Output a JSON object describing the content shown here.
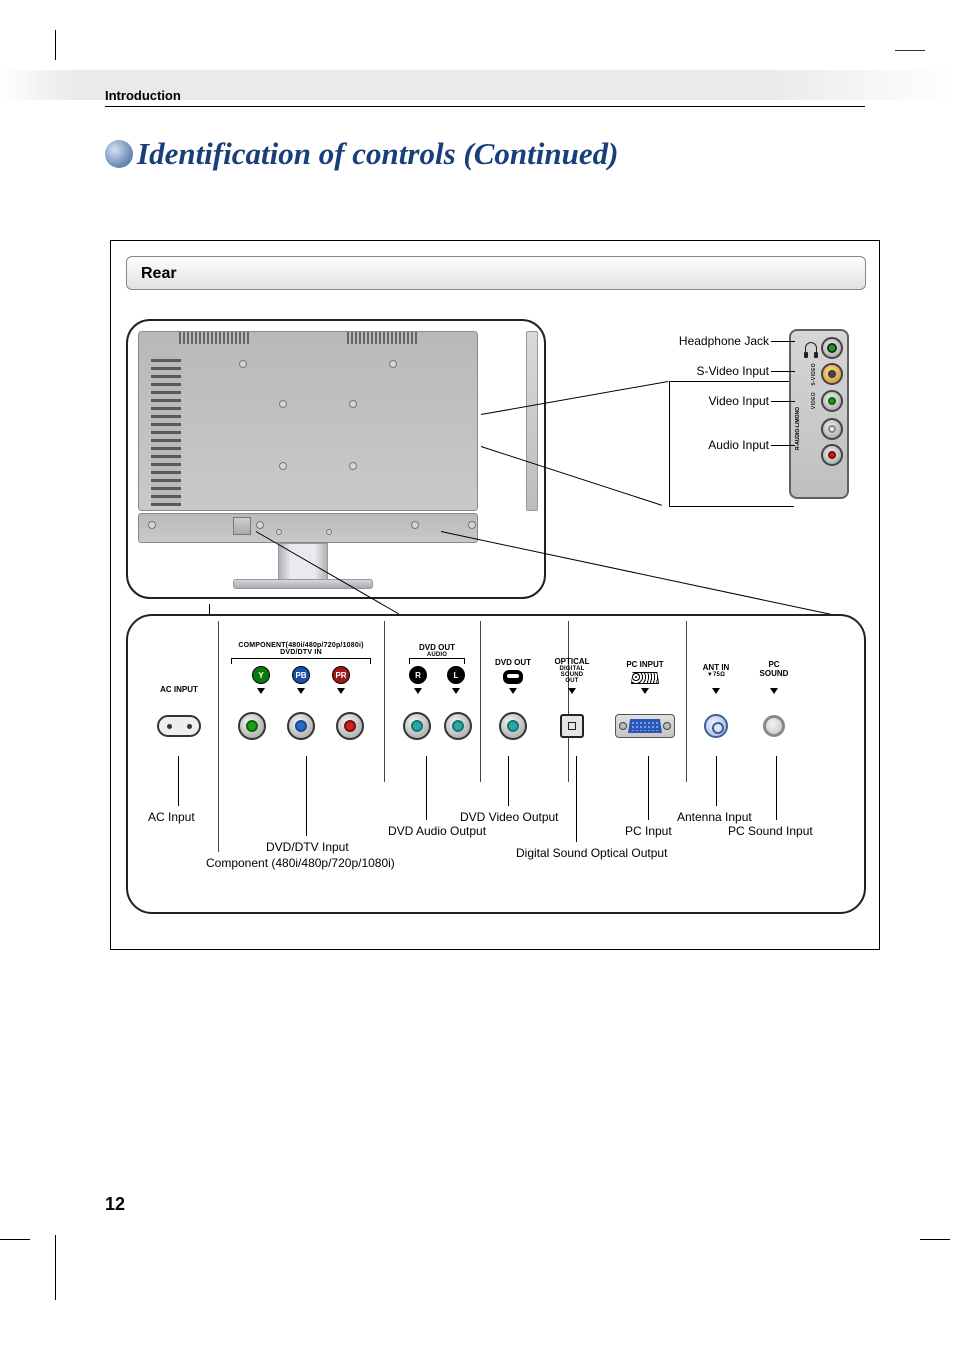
{
  "header": {
    "section": "Introduction",
    "title": "Identification of controls (Continued)"
  },
  "panel": {
    "rear": "Rear"
  },
  "side": {
    "headphone": "Headphone Jack",
    "svideo": "S-Video Input",
    "video": "Video Input",
    "audio": "Audio Input",
    "mini": {
      "svideo": "S-VIDEO",
      "video": "VIDEO",
      "audio_lr": "R-AUDIO-L/MONO"
    }
  },
  "io_top": {
    "ac": "AC INPUT",
    "component_group": "COMPONENT(480i/480p/720p/1080i)",
    "component_sub": "DVD/DTV IN",
    "y": "Y",
    "pb": "PB",
    "pr": "PR",
    "dvdout_audio": "DVD OUT",
    "audio_sub": "AUDIO",
    "r": "R",
    "l": "L",
    "dvdout": "DVD OUT",
    "optical": "OPTICAL",
    "optical_sub1": "DIGITAL",
    "optical_sub2": "SOUND",
    "optical_sub3": "OUT",
    "pcinput": "PC INPUT",
    "antin": "ANT IN",
    "antin_sub": "▼75Ω",
    "pcsound": "PC",
    "pcsound2": "SOUND"
  },
  "io_labels": {
    "ac": "AC Input",
    "dvddtv1": "DVD/DTV Input",
    "dvddtv2": "Component (480i/480p/720p/1080i)",
    "dvd_audio_out": "DVD Audio Output",
    "dvd_video_out": "DVD Video Output",
    "digital_opt": "Digital Sound Optical Output",
    "pc_input": "PC Input",
    "antenna": "Antenna Input",
    "pc_sound": "PC Sound Input"
  },
  "page_number": "12"
}
